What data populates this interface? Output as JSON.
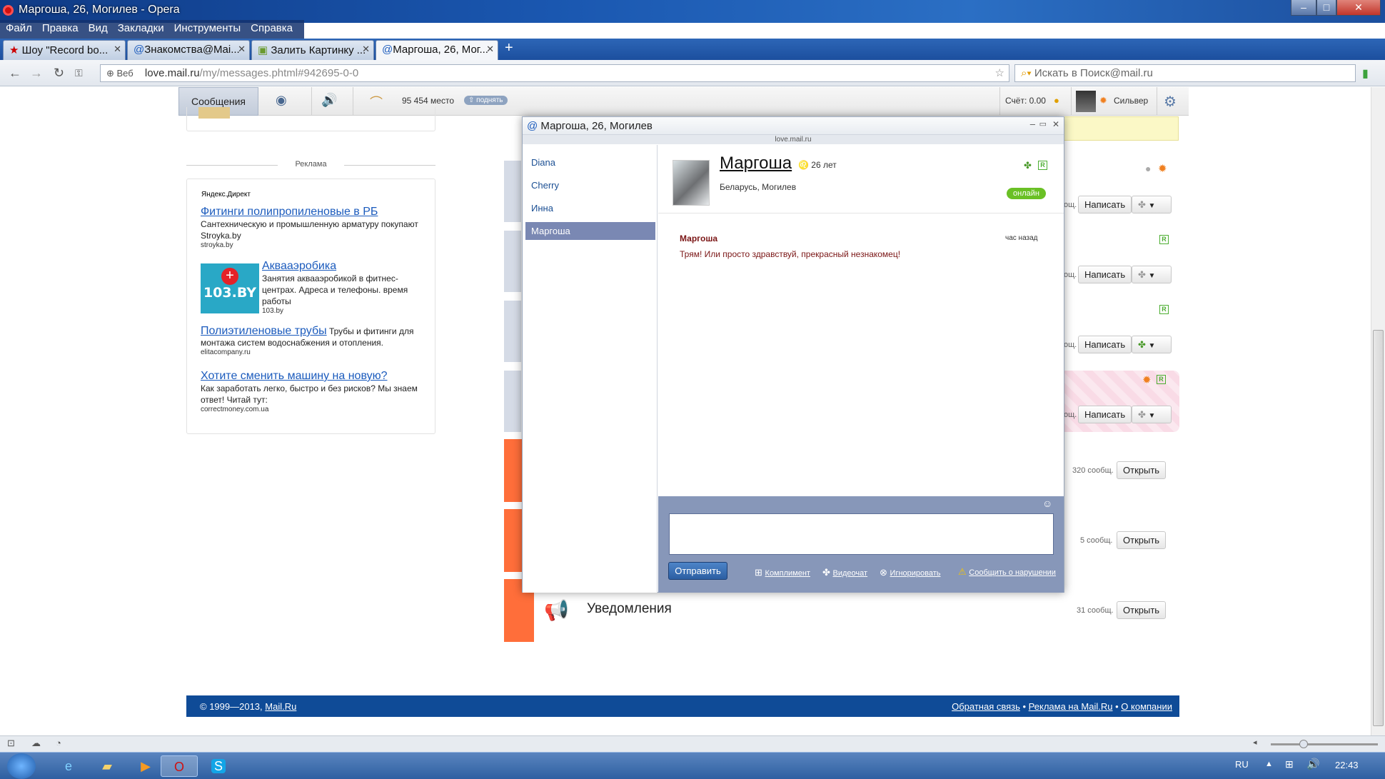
{
  "window": {
    "title": "Маргоша, 26, Могилев - Opera"
  },
  "menu": [
    "Файл",
    "Правка",
    "Вид",
    "Закладки",
    "Инструменты",
    "Справка"
  ],
  "tabs": [
    {
      "label": "Шоу \"Record bo...",
      "active": false
    },
    {
      "label": "Знакомства@Mai...",
      "active": false
    },
    {
      "label": "Залить Картинку ...",
      "active": false
    },
    {
      "label": "Маргоша, 26, Мог...",
      "active": true
    }
  ],
  "address": {
    "badge": "Веб",
    "url_domain": "love.mail.ru",
    "url_path": "/my/messages.phtml#942695-0-0",
    "search_placeholder": "Искать в Поиск@mail.ru"
  },
  "topnav": {
    "messages": "Сообщения",
    "rating": "95 454 место",
    "raise": "поднять",
    "score": "Счёт: 0.00",
    "user": "Сильвер"
  },
  "ads": {
    "section_label": "Реклама",
    "provider": "Яндекс.Директ",
    "items": [
      {
        "title": "Фитинги полипропиленовые в РБ",
        "text": "Сантехническую и промышленную арматуру покупают Stroyka.by",
        "domain": "stroyka.by"
      },
      {
        "title": "Аквааэробика",
        "text": "Занятия аквааэробикой в фитнес-центрах. Адреса и телефоны. время работы",
        "domain": "103.by",
        "logo": "103.BY"
      },
      {
        "title": "Полиэтиленовые трубы",
        "text": "Трубы и фитинги для монтажа систем водоснабжения и отопления.",
        "domain": "elitacompany.ru"
      },
      {
        "title": "Хотите сменить машину на новую?",
        "text": "Как заработать легко, быстро и без рисков? Мы знаем ответ! Читай тут:",
        "domain": "correctmoney.com.ua"
      }
    ]
  },
  "list": {
    "write": "Написать",
    "open": "Открыть",
    "counts": [
      "320 сообщ.",
      "5 сообщ.",
      "31 сообщ."
    ],
    "notifications": "Уведомления",
    "soob_stub": "ощ."
  },
  "dialog": {
    "title": "Маргоша, 26, Могилев",
    "subtitle": "love.mail.ru",
    "contacts": [
      "Diana",
      "Cherry",
      "Инна",
      "Маргоша"
    ],
    "profile": {
      "name": "Маргоша",
      "age": "26 лет",
      "location": "Беларусь, Могилев",
      "status": "онлайн"
    },
    "message": {
      "author": "Маргоша",
      "time": "час назад",
      "text": "Трям! Или просто здравствуй, прекрасный незнакомец!"
    },
    "send": "Отправить",
    "actions": [
      "Комплимент",
      "Видеочат",
      "Игнорировать",
      "Сообщить о нарушении"
    ]
  },
  "footer": {
    "copyright": "© 1999—2013,",
    "brand": "Mail.Ru",
    "links": [
      "Обратная связь",
      "Реклама на Mail.Ru",
      "О компании"
    ]
  },
  "taskbar": {
    "lang": "RU",
    "time": "22:43"
  }
}
